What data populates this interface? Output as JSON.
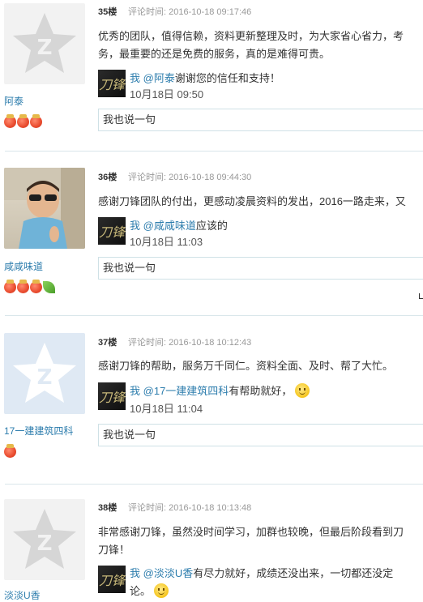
{
  "colors": {
    "link": "#2d7dad",
    "divider": "#d9e6ea",
    "time": "#999999"
  },
  "posts": [
    {
      "floor": "35楼",
      "time": "评论时间: 2016-10-18 09:17:46",
      "username": "阿泰",
      "avatar": "default-qq-avatar-icon",
      "medals": 3,
      "content": [
        "优秀的团队，值得信赖，资料更新整理及时，为大家省心省力，考",
        "务，最重要的还是免费的服务，真的是难得可贵。"
      ],
      "reply": {
        "me": "我",
        "at": "@阿泰",
        "text": "谢谢您的信任和支持！",
        "time": "10月18日 09:50"
      },
      "comment_placeholder": "我也说一句"
    },
    {
      "floor": "36楼",
      "time": "评论时间: 2016-10-18 09:44:30",
      "username": "咸咸味道",
      "avatar": "child-photo",
      "medals": 3,
      "content": [
        "感谢刀锋团队的付出，更感动凌晨资料的发出，2016一路走来，又"
      ],
      "reply": {
        "me": "我",
        "at": "@咸咸味道",
        "text": "应该的",
        "time": "10月18日 11:03"
      },
      "comment_placeholder": "我也说一句"
    },
    {
      "floor": "37楼",
      "time": "评论时间: 2016-10-18 10:12:43",
      "username": "17一建建筑四科",
      "avatar": "default-qq-avatar-icon",
      "medals": 1,
      "content": [
        "感谢刀锋的帮助，服务万千同仁。资料全面、及时、帮了大忙。"
      ],
      "reply": {
        "me": "我",
        "at": "@17一建建筑四科",
        "text": "有帮助就好，",
        "time": "10月18日 11:04"
      },
      "comment_placeholder": "我也说一句"
    },
    {
      "floor": "38楼",
      "time": "评论时间: 2016-10-18 10:13:48",
      "username": "淡淡U香",
      "avatar": "default-qq-avatar-icon",
      "content": [
        "非常感谢刀锋，虽然没时间学习，加群也较晚，但最后阶段看到刀",
        "刀锋！"
      ],
      "reply": {
        "me": "我",
        "at": "@淡淡U香",
        "text": "有尽力就好，成绩还没出来，一切都还没定",
        "text2": "论。"
      }
    }
  ],
  "reply_avatar_text": "刀锋"
}
